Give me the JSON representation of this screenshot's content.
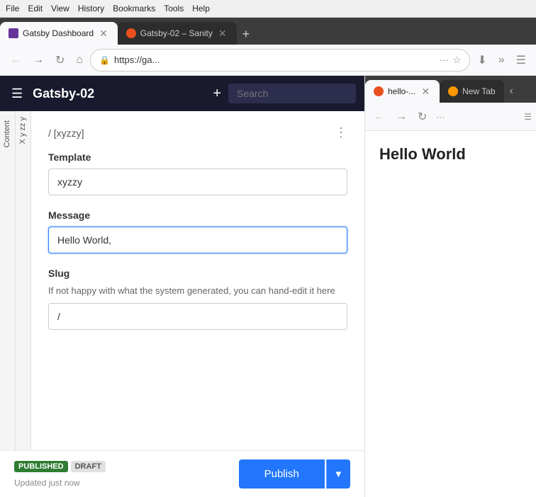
{
  "browser": {
    "menu_items": [
      "File",
      "Edit",
      "View",
      "History",
      "Bookmarks",
      "Tools",
      "Help"
    ],
    "left_tab": {
      "favicon_color": "#663399",
      "title": "Gatsby Dashboard",
      "active": true
    },
    "right_tab": {
      "favicon_color": "#e9501d",
      "title": "Gatsby-02 – Sanity",
      "active": false
    },
    "address": "https://ga...",
    "new_tab_label": "+"
  },
  "right_browser": {
    "tab1_title": "hello-...",
    "tab2_title": "New Tab",
    "hello_world": "Hello World"
  },
  "sanity": {
    "header": {
      "title": "Gatsby-02",
      "search_placeholder": "Search"
    },
    "side_tabs": [
      "Content"
    ],
    "xyz_tabs": [
      "X y zz y"
    ],
    "breadcrumb": "/ [xyzzy]",
    "template_label": "Template",
    "template_value": "xyzzy",
    "message_label": "Message",
    "message_value": "Hello World,",
    "message_placeholder": "",
    "slug_label": "Slug",
    "slug_desc": "If not happy with what the system generated, you can hand-edit it here",
    "slug_value": "/",
    "badges": {
      "published": "PUBLISHED",
      "draft": "DRAFT"
    },
    "updated_text": "Updated just now",
    "publish_btn": "Publish"
  }
}
